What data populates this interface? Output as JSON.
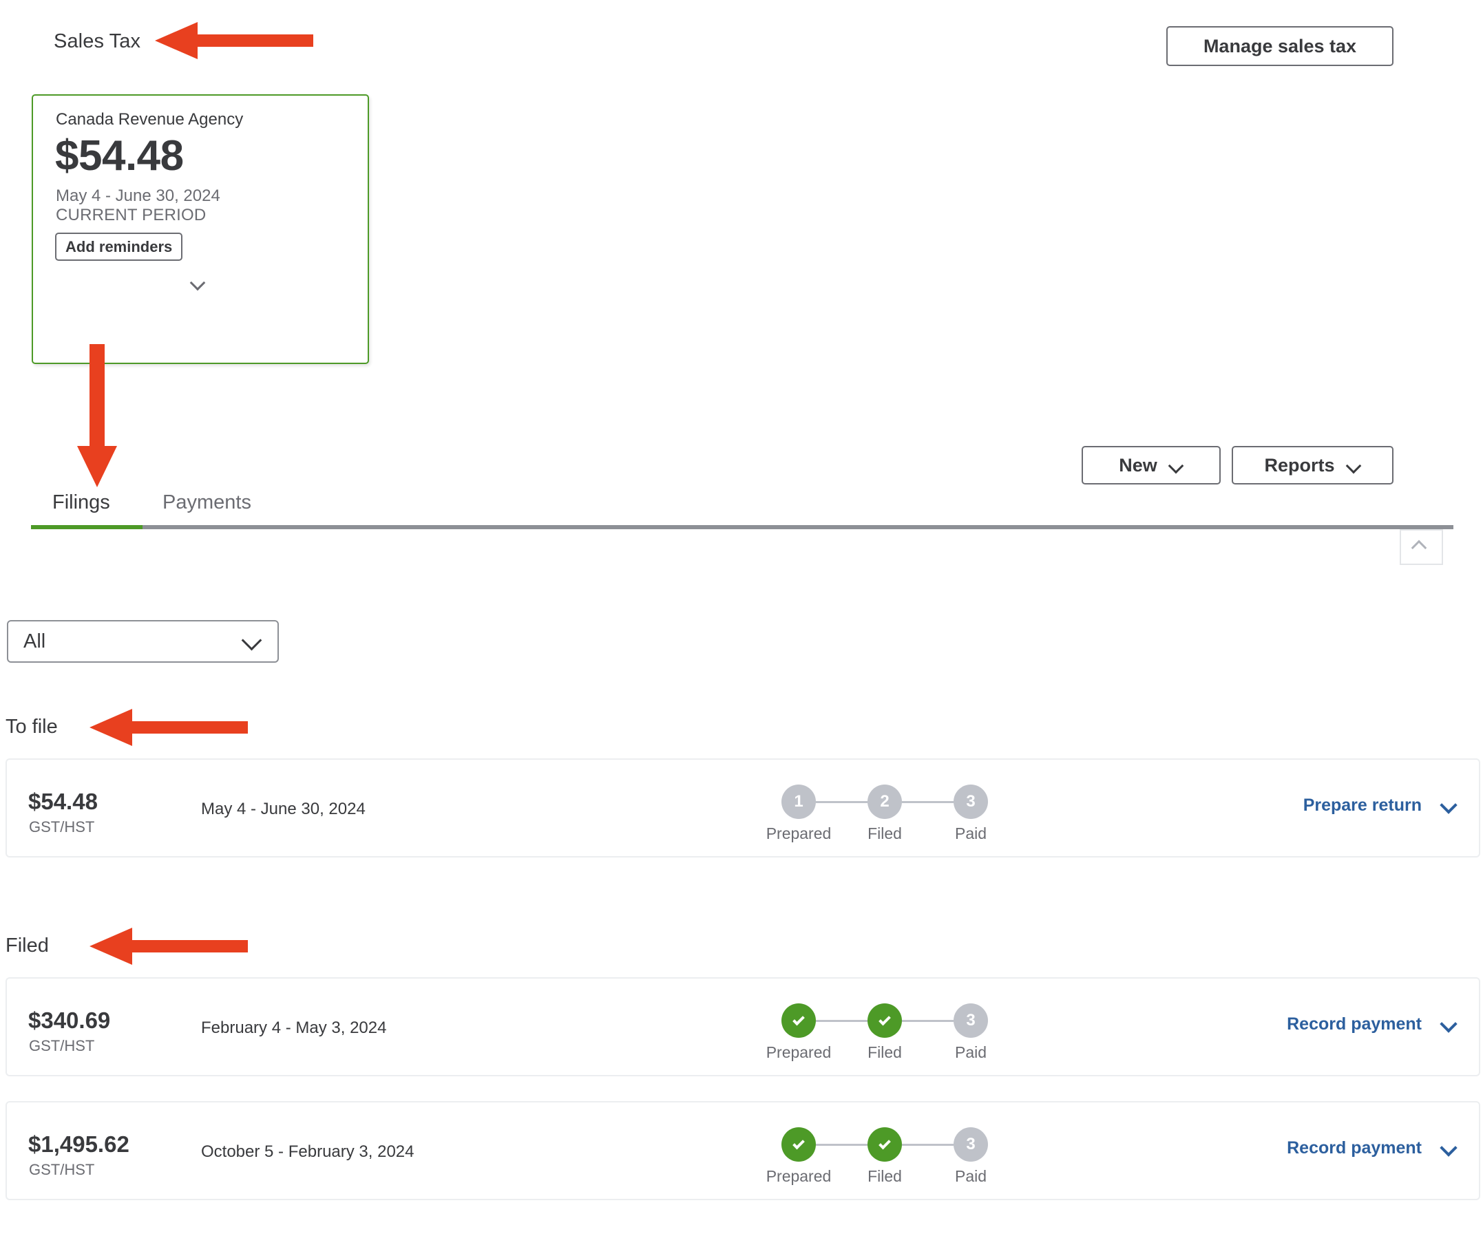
{
  "header": {
    "title": "Sales Tax",
    "manage_button": "Manage sales tax"
  },
  "agency_card": {
    "agency_name": "Canada Revenue Agency",
    "amount": "$54.48",
    "period": "May 4 - June 30, 2024",
    "period_label": "CURRENT PERIOD",
    "add_reminders_button": "Add reminders",
    "expand_icon": "chevron-down-icon",
    "border_color": "#4d9a27"
  },
  "toolbar": {
    "new_button": "New",
    "reports_button": "Reports",
    "dropdown_icon": "chevron-down-icon"
  },
  "tabs": {
    "items": [
      {
        "label": "Filings",
        "active": true
      },
      {
        "label": "Payments",
        "active": false
      }
    ],
    "active_underline_color": "#4d9a27",
    "collapse_icon": "chevron-up-icon"
  },
  "filter": {
    "value": "All",
    "icon": "chevron-down-icon"
  },
  "sections": [
    {
      "title": "To file"
    },
    {
      "title": "Filed"
    }
  ],
  "step_labels": [
    "Prepared",
    "Filed",
    "Paid"
  ],
  "filings": [
    {
      "amount": "$54.48",
      "tax_type": "GST/HST",
      "period": "May 4 - June 30, 2024",
      "steps": [
        {
          "text": "1",
          "done": false
        },
        {
          "text": "2",
          "done": false
        },
        {
          "text": "3",
          "done": false
        }
      ],
      "action_label": "Prepare return",
      "action_icon": "chevron-down-icon"
    },
    {
      "amount": "$340.69",
      "tax_type": "GST/HST",
      "period": "February 4 - May 3, 2024",
      "steps": [
        {
          "text": "",
          "done": true
        },
        {
          "text": "",
          "done": true
        },
        {
          "text": "3",
          "done": false
        }
      ],
      "action_label": "Record payment",
      "action_icon": "chevron-down-icon"
    },
    {
      "amount": "$1,495.62",
      "tax_type": "GST/HST",
      "period": "October 5 - February 3, 2024",
      "steps": [
        {
          "text": "",
          "done": true
        },
        {
          "text": "",
          "done": true
        },
        {
          "text": "3",
          "done": false
        }
      ],
      "action_label": "Record payment",
      "action_icon": "chevron-down-icon"
    }
  ],
  "annotations": {
    "color": "#e8401f",
    "arrows": [
      {
        "name": "arrow-to-sales-tax-title",
        "direction": "left"
      },
      {
        "name": "arrow-from-card-to-filings-tab",
        "direction": "down"
      },
      {
        "name": "arrow-to-to-file-heading",
        "direction": "left"
      },
      {
        "name": "arrow-to-filed-heading",
        "direction": "left"
      }
    ]
  }
}
